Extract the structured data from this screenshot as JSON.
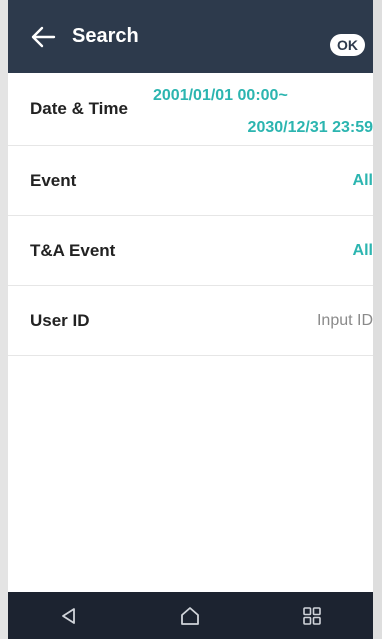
{
  "header": {
    "title": "Search",
    "ok_label": "OK",
    "back_icon": "arrow-left-icon"
  },
  "rows": [
    {
      "label": "Date & Time",
      "start": "2001/01/01 00:00~",
      "end": "2030/12/31 23:59"
    },
    {
      "label": "Event",
      "value": "All"
    },
    {
      "label": "T&A Event",
      "value": "All"
    },
    {
      "label": "User ID",
      "placeholder": "Input ID"
    }
  ],
  "navbar": {
    "back_icon": "triangle-back-icon",
    "home_icon": "house-home-icon",
    "apps_icon": "grid-apps-icon"
  },
  "colors": {
    "header_bg": "#2d3a4c",
    "accent": "#2cb5b0",
    "navbar_bg": "#1c2330"
  }
}
